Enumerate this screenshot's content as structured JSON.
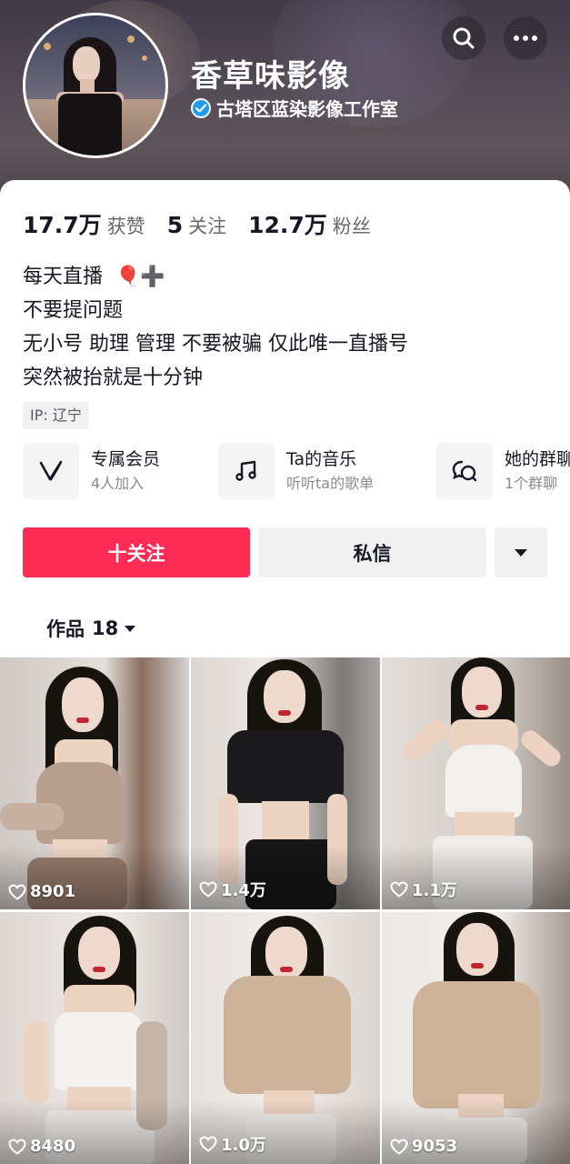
{
  "header": {
    "nickname": "香草味影像",
    "verified_text": "古塔区蓝染影像工作室",
    "buttons": [
      "search-icon",
      "more-icon"
    ]
  },
  "stats": [
    {
      "value": "17.7万",
      "label": "获赞"
    },
    {
      "value": "5",
      "label": "关注"
    },
    {
      "value": "12.7万",
      "label": "粉丝"
    }
  ],
  "bio": {
    "line1": "每天直播",
    "line1_emoji": "🎈➕",
    "line2": "不要提问题",
    "line3": "无小号 助理 管理 不要被骗 仅此唯一直播号",
    "line4": "突然被抬就是十分钟"
  },
  "ip_tag": "IP: 辽宁",
  "features": [
    {
      "icon": "vip-v-icon",
      "title": "专属会员",
      "subtitle": "4人加入"
    },
    {
      "icon": "music-note-icon",
      "title": "Ta的音乐",
      "subtitle": "听听ta的歌单"
    },
    {
      "icon": "group-chat-icon",
      "title": "她的群聊",
      "subtitle": "1个群聊"
    }
  ],
  "actions": {
    "follow_label": "十关注",
    "message_label": "私信",
    "more_icon": "caret-down-icon"
  },
  "works": {
    "label": "作品",
    "count": "18",
    "items": [
      {
        "likes": "8901"
      },
      {
        "likes": "1.4万"
      },
      {
        "likes": "1.1万"
      },
      {
        "likes": "8480"
      },
      {
        "likes": "1.0万"
      },
      {
        "likes": "9053"
      }
    ]
  },
  "colors": {
    "accent": "#fe2c55",
    "verified_blue": "#1f9bf0",
    "text_primary": "#161823",
    "text_secondary": "#68686e",
    "button_gray": "#f1f1f2"
  }
}
